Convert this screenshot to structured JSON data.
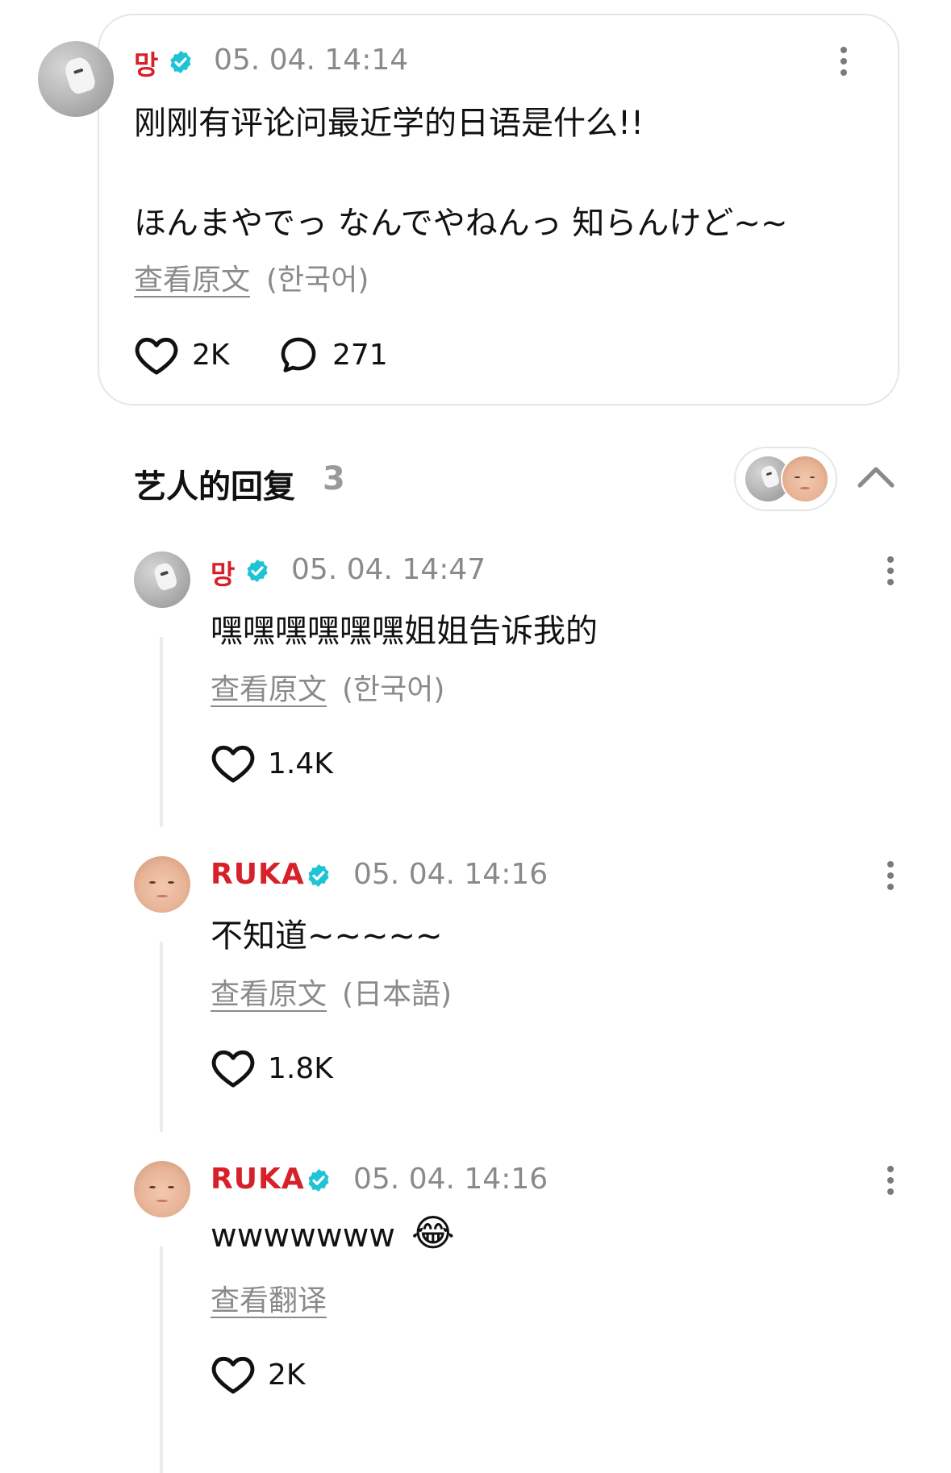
{
  "main_post": {
    "author": "망",
    "timestamp": "05. 04. 14:14",
    "line1": "刚刚有评论问最近学的日语是什么!!",
    "line2": "ほんまやでっ なんでやねんっ 知らんけど~~",
    "see_original": "查看原文",
    "language": "(한국어)",
    "likes": "2K",
    "comments": "271"
  },
  "replies_section": {
    "title": "艺人的回复",
    "count": "3"
  },
  "replies": [
    {
      "author": "망",
      "timestamp": "05. 04. 14:47",
      "text": "嘿嘿嘿嘿嘿嘿姐姐告诉我的",
      "see_original": "查看原文",
      "language": "(한국어)",
      "likes": "1.4K"
    },
    {
      "author": "RUKA",
      "timestamp": "05. 04. 14:16",
      "text": "不知道~~~~~",
      "see_original": "查看原文",
      "language": "(日本語)",
      "likes": "1.8K"
    },
    {
      "author": "RUKA",
      "timestamp": "05. 04. 14:16",
      "text": "wwwwwww",
      "emoji": "😂",
      "see_translation": "查看翻译",
      "likes": "2K"
    }
  ],
  "icons": {
    "verified": "verified-badge-icon",
    "like": "heart-icon",
    "comment": "comment-bubble-icon",
    "more": "more-vertical-icon",
    "collapse": "chevron-up-icon"
  },
  "colors": {
    "author_name": "#d6202a",
    "verified": "#1fc3d6",
    "secondary_text": "#8a8a8a",
    "card_border": "#e6e6e6"
  }
}
